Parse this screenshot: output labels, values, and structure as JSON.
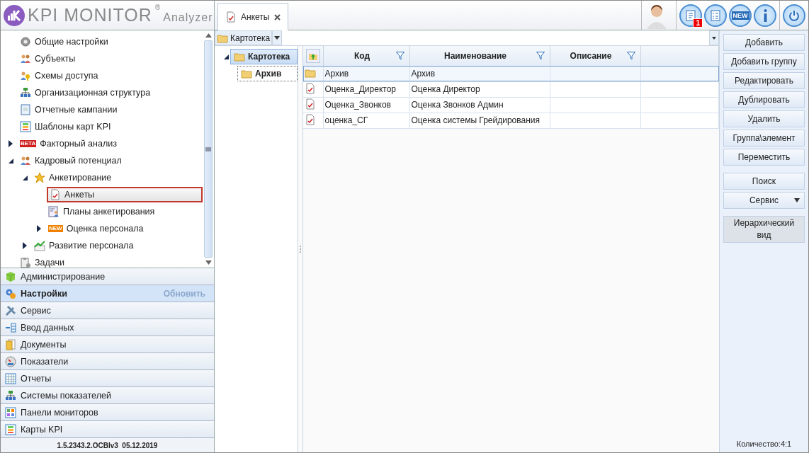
{
  "logo": {
    "brand": "KPI MONITOR",
    "mark": "®",
    "product": "Analyzer"
  },
  "tab": {
    "label": "Анкеты",
    "selected": true
  },
  "toolbar": {
    "notification_badge": "1",
    "new_label": "NEW"
  },
  "nav_tree": [
    {
      "label": "Общие настройки",
      "kind": "gear",
      "selected": false
    },
    {
      "label": "Субъекты",
      "kind": "people",
      "selected": false
    },
    {
      "label": "Схемы доступа",
      "kind": "keys",
      "selected": false
    },
    {
      "label": "Организационная структура",
      "kind": "org",
      "selected": false
    },
    {
      "label": "Отчетные кампании",
      "kind": "book",
      "selected": false
    },
    {
      "label": "Шаблоны карт KPI",
      "kind": "kpi",
      "selected": false
    },
    {
      "label": "Факторный анализ",
      "kind": "beta",
      "tag": "BETA",
      "selected": false,
      "expanded": false
    },
    {
      "label": "Кадровый потенциал",
      "kind": "people",
      "selected": false,
      "expanded": true,
      "children": [
        {
          "label": "Анкетирование",
          "kind": "star",
          "selected": false,
          "expanded": true,
          "children": [
            {
              "label": "Анкеты",
              "kind": "doc",
              "selected": true
            },
            {
              "label": "Планы анкетирования",
              "kind": "plan",
              "selected": false
            },
            {
              "label": "Оценка персонала",
              "kind": "new",
              "tag": "NEW",
              "selected": false,
              "expanded": false
            }
          ]
        },
        {
          "label": "Развитие персонала",
          "kind": "chart",
          "selected": false,
          "expanded": false
        }
      ]
    },
    {
      "label": "Задачи",
      "kind": "tasks",
      "selected": false
    }
  ],
  "nav_sections": [
    {
      "label": "Администрирование",
      "kind": "cube",
      "selected": false
    },
    {
      "label": "Настройки",
      "kind": "gears",
      "selected": true,
      "action": "Обновить"
    },
    {
      "label": "Сервис",
      "kind": "tools",
      "selected": false
    },
    {
      "label": "Ввод данных",
      "kind": "input",
      "selected": false
    },
    {
      "label": "Документы",
      "kind": "docs",
      "selected": false
    },
    {
      "label": "Показатели",
      "kind": "gauge",
      "selected": false
    },
    {
      "label": "Отчеты",
      "kind": "table",
      "selected": false
    },
    {
      "label": "Системы показателей",
      "kind": "org",
      "selected": false
    },
    {
      "label": "Панели мониторов",
      "kind": "panel",
      "selected": false
    },
    {
      "label": "Карты KPI",
      "kind": "kpi",
      "selected": false
    }
  ],
  "version": "1.5.2343.2.OCBIv3  05.12.2019",
  "breadcrumb": {
    "label": "Картотека"
  },
  "folder_tree": [
    {
      "label": "Картотека",
      "selected": true,
      "expanded": true,
      "children": [
        {
          "label": "Архив",
          "selected": false
        }
      ]
    }
  ],
  "table": {
    "columns": [
      "Код",
      "Наименование",
      "Описание"
    ],
    "rows": [
      {
        "kind": "folder",
        "code": "Архив",
        "name": "Архив",
        "selected": true
      },
      {
        "kind": "form",
        "code": "Оценка_Директор",
        "name": "Оценка Директор",
        "selected": false
      },
      {
        "kind": "form",
        "code": "Оценка_Звонков",
        "name": "Оценка Звонков Админ",
        "selected": false
      },
      {
        "kind": "form",
        "code": "оценка_СГ",
        "name": "Оценка системы Грейдирования",
        "selected": false
      }
    ]
  },
  "action_groups": [
    [
      {
        "label": "Добавить",
        "kind": "button"
      },
      {
        "label": "Добавить группу",
        "kind": "button"
      },
      {
        "label": "Редактировать",
        "kind": "button"
      },
      {
        "label": "Дублировать",
        "kind": "button"
      },
      {
        "label": "Удалить",
        "kind": "button"
      },
      {
        "label": "Группа\\элемент",
        "kind": "button"
      },
      {
        "label": "Переместить",
        "kind": "button"
      }
    ],
    [
      {
        "label": "Поиск",
        "kind": "button"
      },
      {
        "label": "Сервис",
        "kind": "menu"
      }
    ],
    [
      {
        "label": "Иерархический вид",
        "kind": "toggle",
        "on": true
      }
    ]
  ],
  "status": "Количество:4:1"
}
